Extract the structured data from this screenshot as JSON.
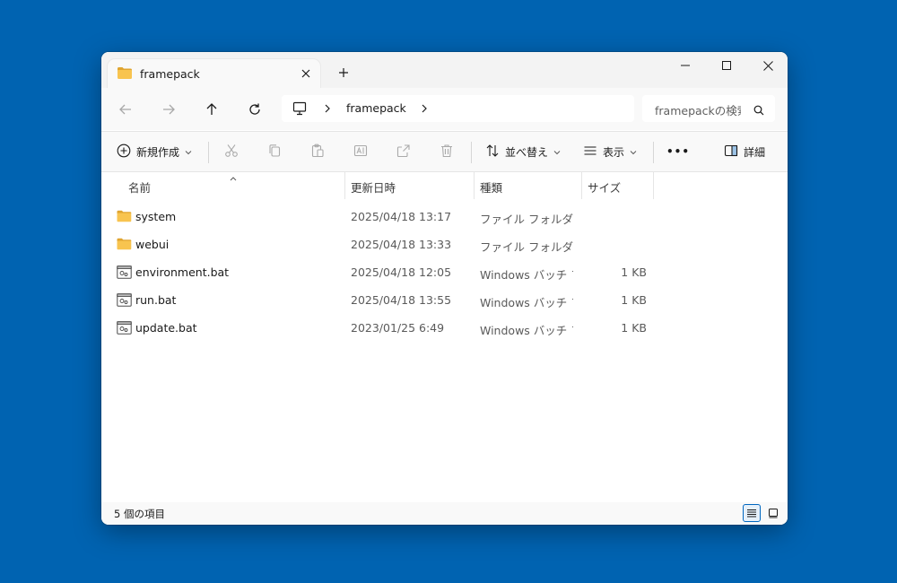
{
  "tab": {
    "title": "framepack"
  },
  "address": {
    "crumb": "framepack"
  },
  "search": {
    "placeholder": "framepackの検索"
  },
  "commands": {
    "new": "新規作成",
    "sort": "並べ替え",
    "view": "表示",
    "more": "•••",
    "details": "詳細"
  },
  "columns": {
    "name": "名前",
    "date": "更新日時",
    "type": "種類",
    "size": "サイズ"
  },
  "files": [
    {
      "name": "system",
      "date": "2025/04/18 13:17",
      "type": "ファイル フォルダー",
      "size": "",
      "icon": "folder-icon"
    },
    {
      "name": "webui",
      "date": "2025/04/18 13:33",
      "type": "ファイル フォルダー",
      "size": "",
      "icon": "folder-icon"
    },
    {
      "name": "environment.bat",
      "date": "2025/04/18 12:05",
      "type": "Windows バッチ ファイル",
      "size": "1 KB",
      "icon": "batch-file-icon"
    },
    {
      "name": "run.bat",
      "date": "2025/04/18 13:55",
      "type": "Windows バッチ ファイル",
      "size": "1 KB",
      "icon": "batch-file-icon"
    },
    {
      "name": "update.bat",
      "date": "2023/01/25 6:49",
      "type": "Windows バッチ ファイル",
      "size": "1 KB",
      "icon": "batch-file-icon"
    }
  ],
  "status": {
    "count": "5 個の項目"
  },
  "colors": {
    "desktop": "#0063b1",
    "folder": "#f8c44f",
    "accent": "#0067c0"
  }
}
